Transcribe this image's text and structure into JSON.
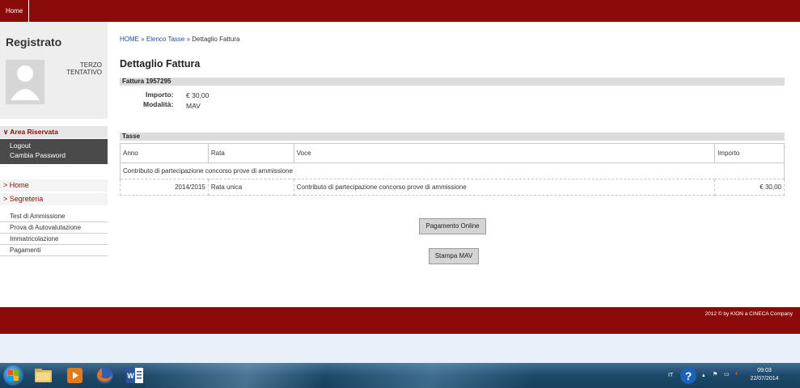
{
  "topbar": {
    "home_tab": "Home"
  },
  "sidebar": {
    "title": "Registrato",
    "user_name": "TERZO TENTATIVO",
    "area_riservata": "Area Riservata",
    "area_items": [
      "Logout",
      "Cambia Password"
    ],
    "nav_home": "Home",
    "nav_segreteria": "Segreteria",
    "segreteria_items": [
      "Test di Ammissione",
      "Prova di Autovalutazione",
      "Immatricolazione",
      "Pagamenti"
    ]
  },
  "breadcrumb": {
    "home": "HOME",
    "sep": "»",
    "elenco": "Elenco Tasse",
    "current": "Dettaglio Fattura"
  },
  "page_title": "Dettaglio Fattura",
  "fattura": {
    "header": "Fattura 1957295",
    "importo_label": "Importo:",
    "importo_value": "€ 30,00",
    "modalita_label": "Modalità:",
    "modalita_value": "MAV"
  },
  "tasse": {
    "header": "Tasse",
    "columns": [
      "Anno",
      "Rata",
      "Voce",
      "Importo"
    ],
    "group_label": "Contributo di partecipazione concorso prove di ammissione",
    "rows": [
      {
        "anno": "2014/2015",
        "rata": "Rata unica",
        "voce": "Contributo di partecipazione concorso prove di ammissione",
        "importo": "€ 30,00"
      }
    ]
  },
  "buttons": {
    "pagamento_online": "Pagamento Online",
    "stampa_mav": "Stampa MAV"
  },
  "footer": {
    "copyright": "2012 © by KION a CINECA Company"
  },
  "taskbar": {
    "tray_lang": "IT",
    "time": "09:03",
    "date": "22/07/2014",
    "icons": [
      "windows-start-icon",
      "file-explorer-icon",
      "media-player-icon",
      "firefox-icon",
      "word-icon"
    ]
  },
  "colors": {
    "brand_red": "#8b0a0a",
    "dark_menu": "#4a4a4a",
    "link_blue": "#1a4fa0"
  }
}
